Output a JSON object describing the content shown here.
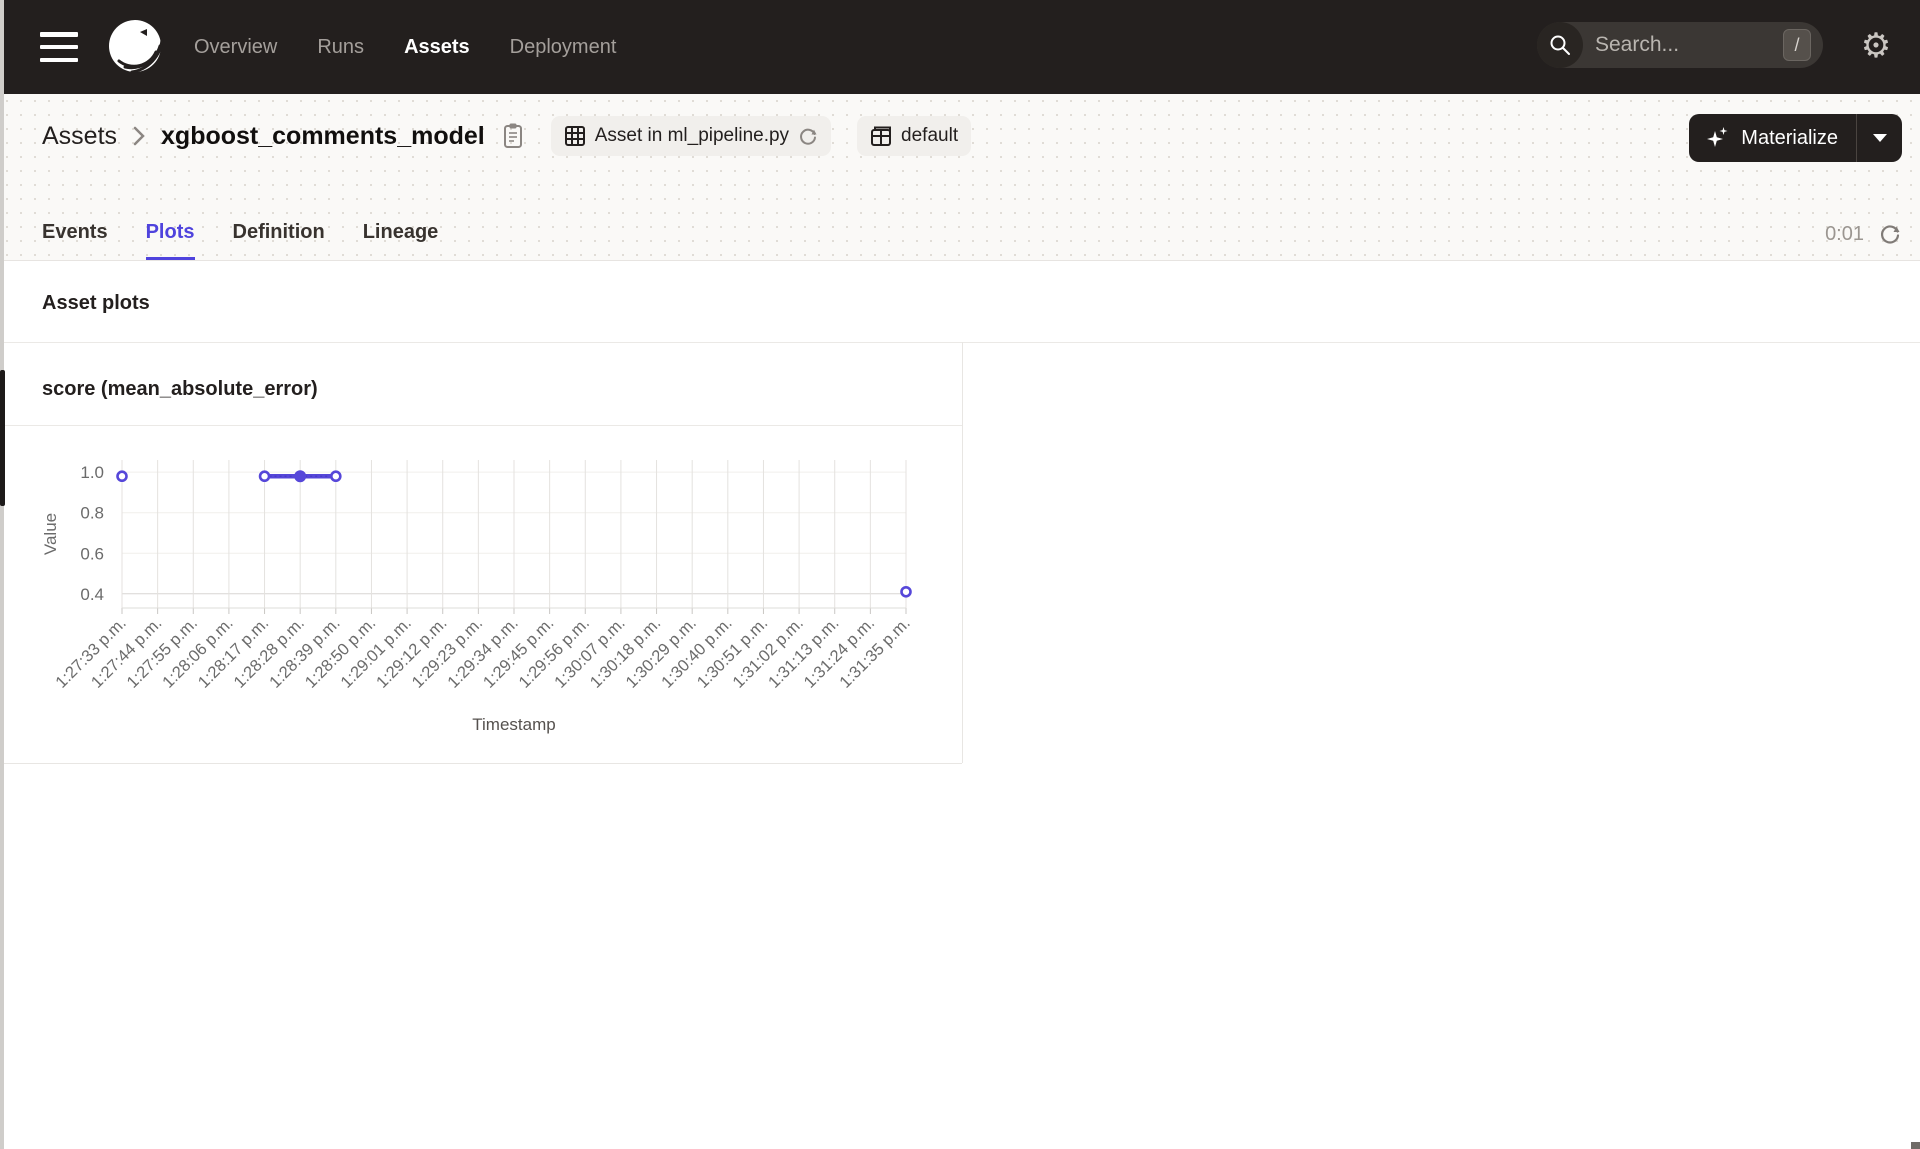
{
  "navbar": {
    "items": [
      {
        "label": "Overview",
        "active": false
      },
      {
        "label": "Runs",
        "active": false
      },
      {
        "label": "Assets",
        "active": true
      },
      {
        "label": "Deployment",
        "active": false
      }
    ],
    "search_placeholder": "Search...",
    "search_shortcut": "/"
  },
  "breadcrumb": {
    "root": "Assets",
    "current": "xgboost_comments_model"
  },
  "badges": {
    "code_location": "Asset in ml_pipeline.py",
    "group": "default"
  },
  "materialize_label": "Materialize",
  "tabs": [
    {
      "label": "Events",
      "active": false
    },
    {
      "label": "Plots",
      "active": true
    },
    {
      "label": "Definition",
      "active": false
    },
    {
      "label": "Lineage",
      "active": false
    }
  ],
  "refresh_timer": "0:01",
  "section_title": "Asset plots",
  "chart_data": {
    "type": "line",
    "title": "score (mean_absolute_error)",
    "xlabel": "Timestamp",
    "ylabel": "Value",
    "categories": [
      "1:27:33 p.m.",
      "1:27:44 p.m.",
      "1:27:55 p.m.",
      "1:28:06 p.m.",
      "1:28:17 p.m.",
      "1:28:28 p.m.",
      "1:28:39 p.m.",
      "1:28:50 p.m.",
      "1:29:01 p.m.",
      "1:29:12 p.m.",
      "1:29:23 p.m.",
      "1:29:34 p.m.",
      "1:29:45 p.m.",
      "1:29:56 p.m.",
      "1:30:07 p.m.",
      "1:30:18 p.m.",
      "1:30:29 p.m.",
      "1:30:40 p.m.",
      "1:30:51 p.m.",
      "1:31:02 p.m.",
      "1:31:13 p.m.",
      "1:31:24 p.m.",
      "1:31:35 p.m."
    ],
    "series": [
      {
        "name": "score (mean_absolute_error)",
        "values": [
          0.98,
          null,
          null,
          null,
          0.98,
          0.98,
          0.98,
          null,
          null,
          null,
          null,
          null,
          null,
          null,
          null,
          null,
          null,
          null,
          null,
          null,
          null,
          null,
          0.41
        ]
      }
    ],
    "marker_filled_index": 5,
    "yticks": [
      0.4,
      0.6,
      0.8,
      1.0
    ],
    "ylim": [
      0.33,
      1.06
    ],
    "grid": true,
    "legend_position": "none"
  },
  "colors": {
    "accent": "#4f43dd",
    "line": "#5647d9",
    "navbar_bg": "#231f1e",
    "header_bg": "#faf9f7",
    "badge_bg": "#f1efec",
    "muted_text": "#9b9691",
    "axis_text": "#6b6b6b"
  }
}
